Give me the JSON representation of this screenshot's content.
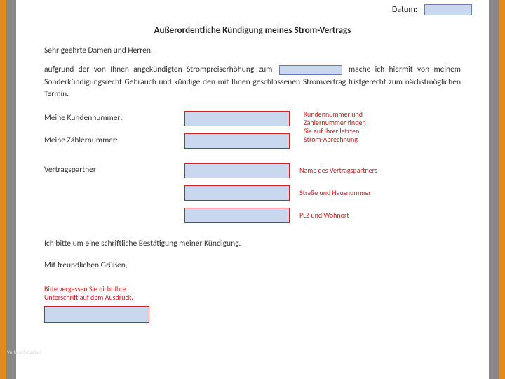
{
  "header": {
    "date_label": "Datum:"
  },
  "title": "Außerordentliche Kündigung meines Strom-Vertrags",
  "salutation": "Sehr geehrte Damen und Herren,",
  "paragraph_pre": "aufgrund der von Ihnen angekündigten Strompreiserhöhung zum",
  "paragraph_post": "mache ich hiermit von meinem Sonderkündigungsrecht Gebrauch und kündige den mit Ihnen geschlossenen Stromvertrag fristgerecht zum nächstmöglichen Termin.",
  "fields": {
    "kundennummer_label": "Meine Kundennummer:",
    "zaehlernummer_label": "Meine Zählernummer:",
    "vertragspartner_label": "Vertragspartner"
  },
  "hints": {
    "kdnr_multi_1": "Kundennummer und",
    "kdnr_multi_2": "Zählernummer finden",
    "kdnr_multi_3": "Sie auf Ihrer letzten",
    "kdnr_multi_4": "Strom-Abrechnung",
    "partner_name": "Name des Vertragspartners",
    "partner_street": "Straße und Hausnummer",
    "partner_city": "PLZ und Wohnort"
  },
  "confirm_text": "Ich bitte um eine schriftliche Bestätigung meiner Kündigung.",
  "closing": "Mit freundlichen Grüßen,",
  "signature_hint_1": "Bitte vergessen Sie nicht Ihre",
  "signature_hint_2": "Unterschrift auf dem Ausdruck.",
  "watermark": "Vorlage Ratgeber"
}
